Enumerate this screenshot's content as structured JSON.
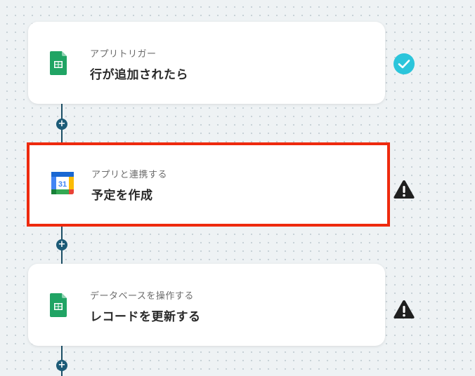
{
  "flow": {
    "steps": [
      {
        "subtitle": "アプリトリガー",
        "title": "行が追加されたら",
        "app_icon": "google-sheets-icon",
        "status_icon": "check-circle-icon",
        "status_color": "#2bc5db"
      },
      {
        "subtitle": "アプリと連携する",
        "title": "予定を作成",
        "app_icon": "google-calendar-icon",
        "calendar_day": "31",
        "status_icon": "warning-triangle-icon",
        "status_color": "#1f1f1f",
        "selected": true,
        "highlight_color": "#ee2a0e"
      },
      {
        "subtitle": "データベースを操作する",
        "title": "レコードを更新する",
        "app_icon": "google-sheets-icon",
        "status_icon": "warning-triangle-icon",
        "status_color": "#1f1f1f"
      }
    ],
    "add_button_icon": "plus-icon",
    "add_button_label": "+",
    "connector_color": "#1c4f66"
  }
}
